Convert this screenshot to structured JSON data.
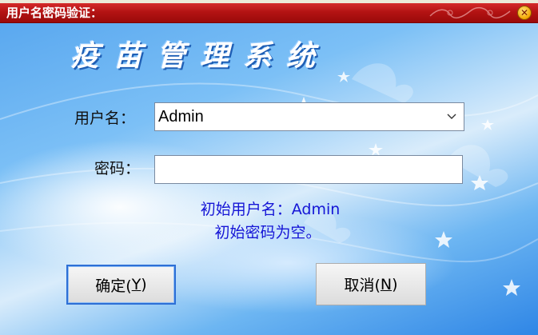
{
  "window": {
    "title": "用户名密码验证：",
    "close_icon": "close-icon"
  },
  "app": {
    "title": "疫苗管理系统"
  },
  "form": {
    "username_label": "用户名：",
    "username_value": "Admin",
    "password_label": "密码：",
    "password_value": ""
  },
  "hints": {
    "line1": "初始用户名：Admin",
    "line2": "初始密码为空。"
  },
  "buttons": {
    "ok_label": "确定(",
    "ok_key": "Y",
    "ok_suffix": ")",
    "cancel_label": "取消(",
    "cancel_key": "N",
    "cancel_suffix": ")"
  },
  "colors": {
    "titlebar": "#b31313",
    "hint_text": "#1515d6",
    "background": "#2f86e6"
  }
}
